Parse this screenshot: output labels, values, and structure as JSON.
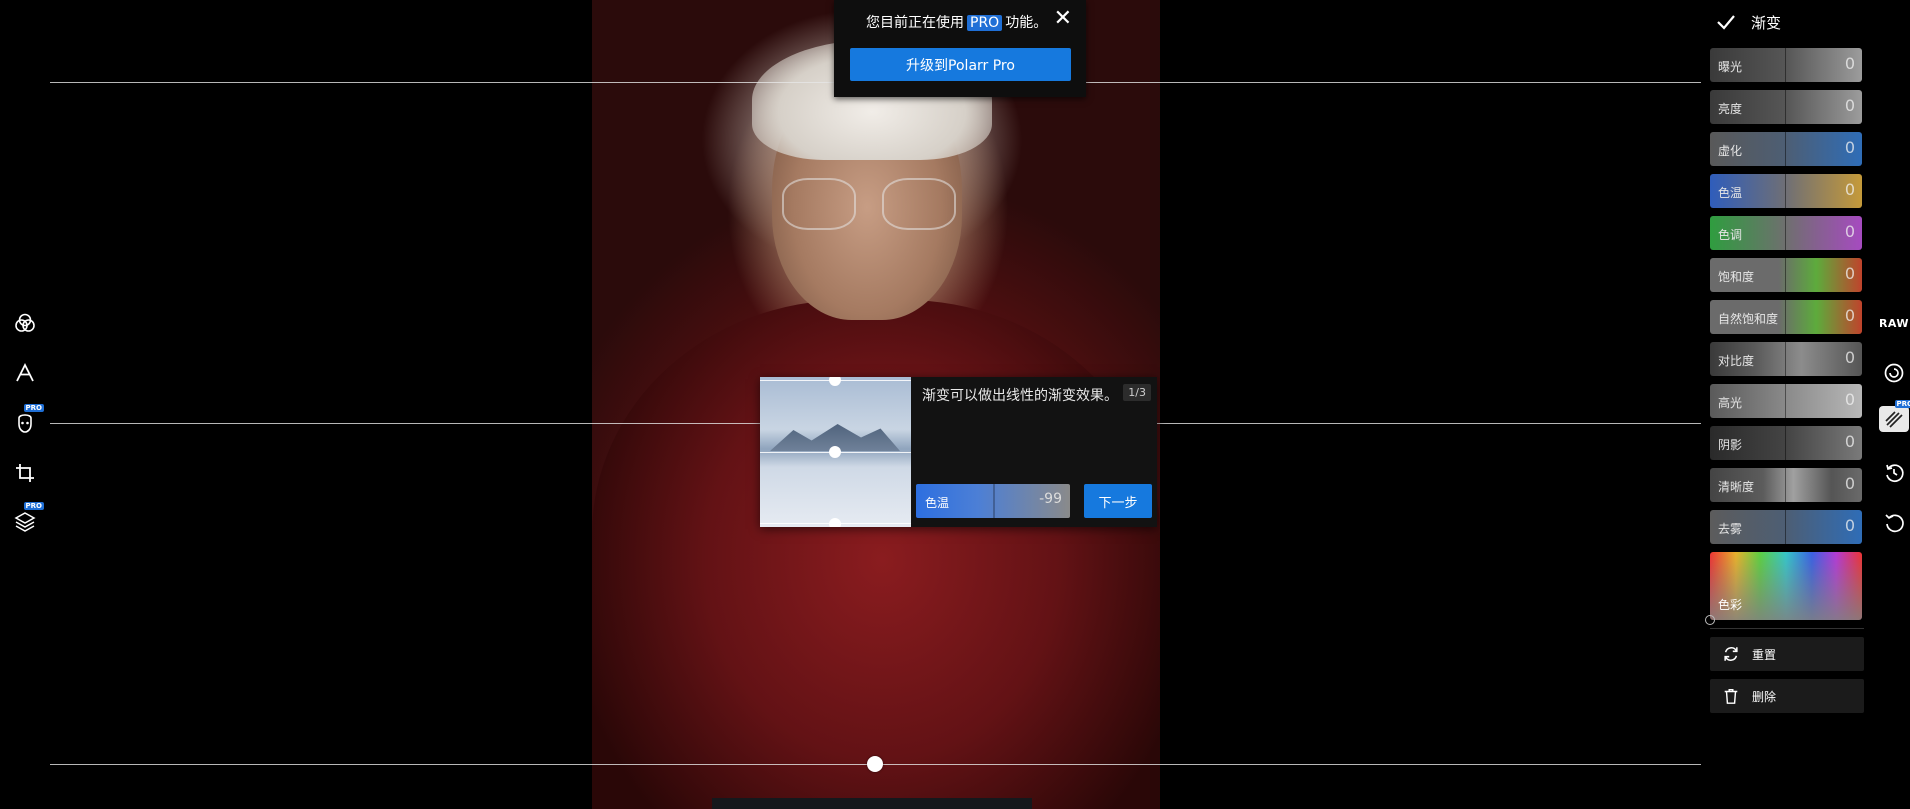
{
  "pro_banner": {
    "message_before": "您目前正在使用",
    "pro_tag": "PRO",
    "message_after": "功能。",
    "upgrade_label": "升级到Polarr Pro"
  },
  "tutorial": {
    "text": "渐变可以做出线性的渐变效果。",
    "step": "1/3",
    "slider_label": "色温",
    "slider_value": "-99",
    "next_label": "下一步"
  },
  "left_toolbar": {
    "items": [
      {
        "icon": "filters-icon"
      },
      {
        "icon": "text-icon"
      },
      {
        "icon": "face-icon",
        "badge": "PRO"
      },
      {
        "icon": "crop-icon"
      },
      {
        "icon": "layers-icon",
        "badge": "PRO"
      }
    ]
  },
  "right_panel": {
    "title": "渐变",
    "sliders": [
      {
        "label": "曝光",
        "value": "0"
      },
      {
        "label": "亮度",
        "value": "0"
      },
      {
        "label": "虚化",
        "value": "0"
      },
      {
        "label": "色温",
        "value": "0"
      },
      {
        "label": "色调",
        "value": "0"
      },
      {
        "label": "饱和度",
        "value": "0"
      },
      {
        "label": "自然饱和度",
        "value": "0"
      },
      {
        "label": "对比度",
        "value": "0"
      },
      {
        "label": "高光",
        "value": "0"
      },
      {
        "label": "阴影",
        "value": "0"
      },
      {
        "label": "清晰度",
        "value": "0"
      },
      {
        "label": "去雾",
        "value": "0"
      }
    ],
    "color_label": "色彩",
    "reset_label": "重置",
    "delete_label": "删除"
  },
  "right_rail": {
    "raw_label": "RAW",
    "pro_badge": "PRO"
  }
}
